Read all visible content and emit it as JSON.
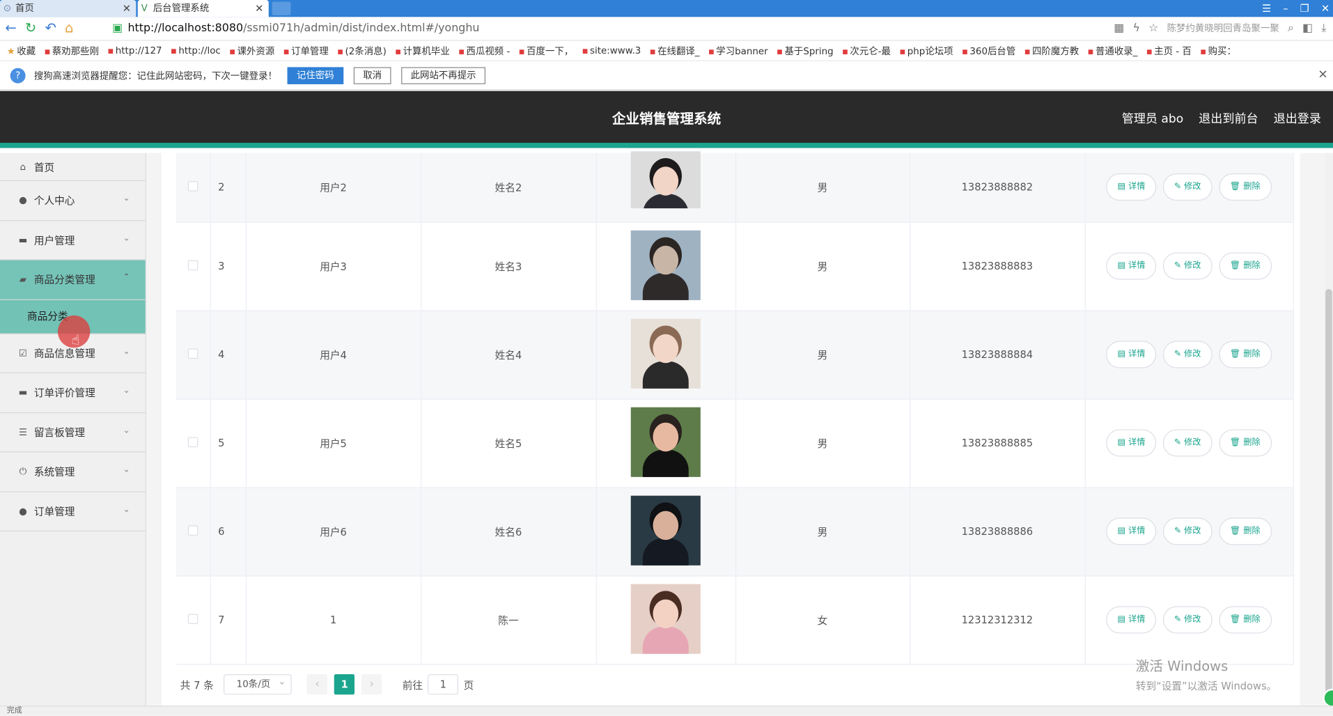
{
  "browser": {
    "tabs": [
      {
        "label": "首页"
      },
      {
        "label": "后台管理系统"
      }
    ],
    "url_host": "http://localhost:8080",
    "url_path": "/ssmi071h/admin/dist/index.html#/yonghu",
    "search_hint": "陈梦约黄晓明回青岛聚一聚",
    "bookmarks": [
      "收藏",
      "蔡劝那些刚",
      "http://127",
      "http://loc",
      "课外资源",
      "订单管理",
      "(2条消息)",
      "计算机毕业",
      "西瓜视频 -",
      "百度一下，",
      "site:www.3",
      "在线翻译_",
      "学习banner",
      "基于Spring",
      "次元仑-最",
      "php论坛项",
      "360后台管",
      "四阶魔方教",
      "普通收录_",
      "主页 - 百",
      "购买："
    ],
    "pw_prompt": "搜狗高速浏览器提醒您：记住此网站密码，下次一键登录！",
    "pw_remember": "记住密码",
    "pw_cancel": "取消",
    "pw_never": "此网站不再提示"
  },
  "header": {
    "title": "企业销售管理系统",
    "admin": "管理员 abo",
    "to_front": "退出到前台",
    "logout": "退出登录"
  },
  "sidebar": {
    "items": [
      {
        "label": "首页",
        "icon": "home-icon"
      },
      {
        "label": "个人中心",
        "icon": "user-icon"
      },
      {
        "label": "用户管理",
        "icon": "monitor-icon"
      },
      {
        "label": "商品分类管理",
        "icon": "briefcase-icon"
      },
      {
        "label": "商品信息管理",
        "icon": "checklist-icon"
      },
      {
        "label": "订单评价管理",
        "icon": "monitor-icon"
      },
      {
        "label": "留言板管理",
        "icon": "sliders-icon"
      },
      {
        "label": "系统管理",
        "icon": "power-icon"
      },
      {
        "label": "订单管理",
        "icon": "user-icon"
      }
    ],
    "sub_label": "商品分类"
  },
  "table": {
    "rows": [
      {
        "idx": "2",
        "account": "用户2",
        "name": "姓名2",
        "gender": "男",
        "phone": "13823888882",
        "skin": "#f1d5c6",
        "hair": "#1d1b1c",
        "shirt": "#2b2b33",
        "bg": "#dcdcdc"
      },
      {
        "idx": "3",
        "account": "用户3",
        "name": "姓名3",
        "gender": "男",
        "phone": "13823888883",
        "skin": "#c8b5a6",
        "hair": "#2b2623",
        "shirt": "#2f2a2a",
        "bg": "#9fb2c2"
      },
      {
        "idx": "4",
        "account": "用户4",
        "name": "姓名4",
        "gender": "男",
        "phone": "13823888884",
        "skin": "#f2d7c8",
        "hair": "#8a6a55",
        "shirt": "#2a2a2a",
        "bg": "#e7e0d8"
      },
      {
        "idx": "5",
        "account": "用户5",
        "name": "姓名5",
        "gender": "男",
        "phone": "13823888885",
        "skin": "#e8b9a1",
        "hair": "#2a221f",
        "shirt": "#111111",
        "bg": "#5e7c4a"
      },
      {
        "idx": "6",
        "account": "用户6",
        "name": "姓名6",
        "gender": "男",
        "phone": "13823888886",
        "skin": "#d9b09a",
        "hair": "#0f1114",
        "shirt": "#151a22",
        "bg": "#2a3a44"
      },
      {
        "idx": "7",
        "account": "1",
        "name": "陈一",
        "gender": "女",
        "phone": "12312312312",
        "skin": "#f3d2c4",
        "hair": "#4a2d22",
        "shirt": "#e7a6b4",
        "bg": "#e6cfc6"
      }
    ],
    "btn_detail": "详情",
    "btn_edit": "修改",
    "btn_delete": "删除"
  },
  "pager": {
    "total": "共 7 条",
    "size": "10条/页",
    "current": "1",
    "goto": "前往",
    "input": "1",
    "page_suffix": "页"
  },
  "watermark": {
    "line1": "激活 Windows",
    "line2": "转到“设置”以激活 Windows。"
  },
  "status": "完成"
}
